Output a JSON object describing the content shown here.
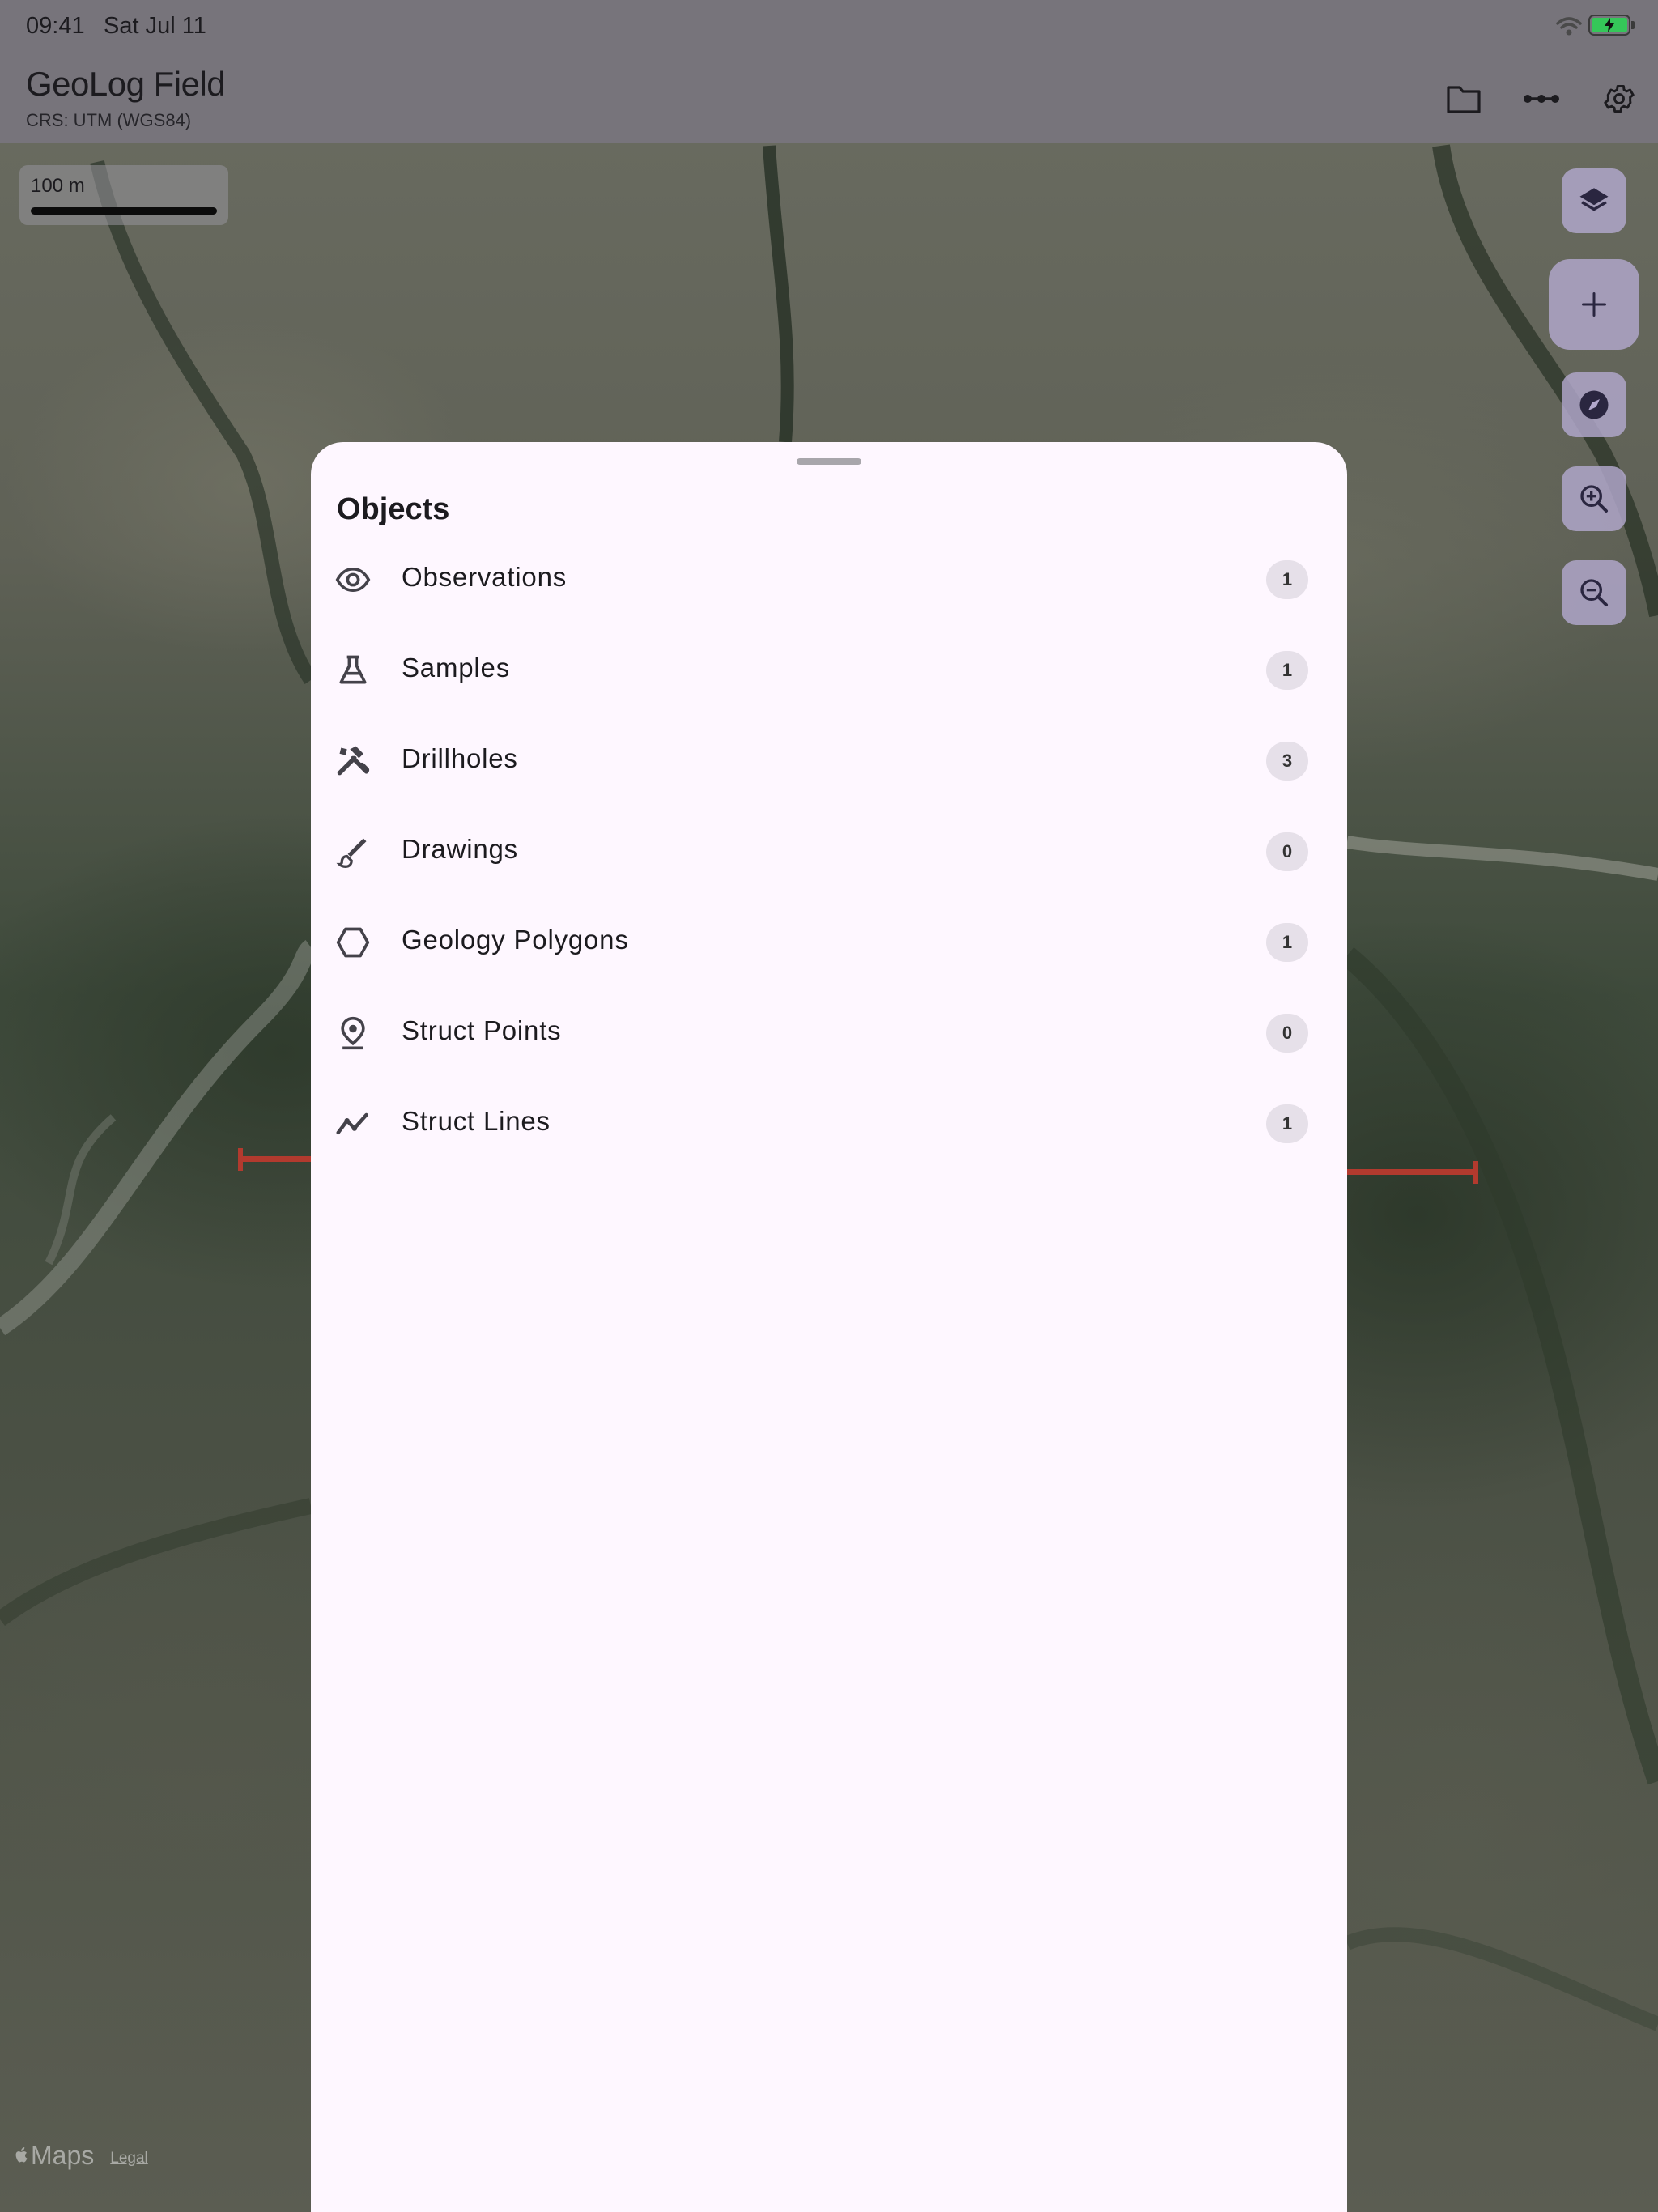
{
  "status_bar": {
    "time": "09:41",
    "date": "Sat Jul 11",
    "icons": [
      "wifi-icon",
      "battery-charging-icon"
    ]
  },
  "app_bar": {
    "title": "GeoLog Field",
    "subtitle": "CRS: UTM (WGS84)",
    "actions": [
      "folder-icon",
      "line-measure-icon",
      "gear-icon"
    ]
  },
  "map": {
    "scale_label": "100 m",
    "controls": [
      "layers-icon",
      "add-icon",
      "compass-icon",
      "zoom-in-icon",
      "zoom-out-icon"
    ],
    "attribution": {
      "maps": "Maps",
      "legal": "Legal"
    },
    "marker_color": "#b23a2e"
  },
  "sheet": {
    "title": "Objects",
    "items": [
      {
        "label": "Observations",
        "count": "1",
        "icon": "eye-icon"
      },
      {
        "label": "Samples",
        "count": "1",
        "icon": "flask-icon"
      },
      {
        "label": "Drillholes",
        "count": "3",
        "icon": "tools-icon"
      },
      {
        "label": "Drawings",
        "count": "0",
        "icon": "brush-icon"
      },
      {
        "label": "Geology Polygons",
        "count": "1",
        "icon": "hexagon-icon"
      },
      {
        "label": "Struct Points",
        "count": "0",
        "icon": "pin-icon"
      },
      {
        "label": "Struct Lines",
        "count": "1",
        "icon": "polyline-icon"
      }
    ]
  },
  "colors": {
    "sheet_background": "#fef7ff",
    "badge_background": "#e6e0e9",
    "fab_background": "#b2a8cd",
    "scrim_app_bar": "#77747b"
  }
}
